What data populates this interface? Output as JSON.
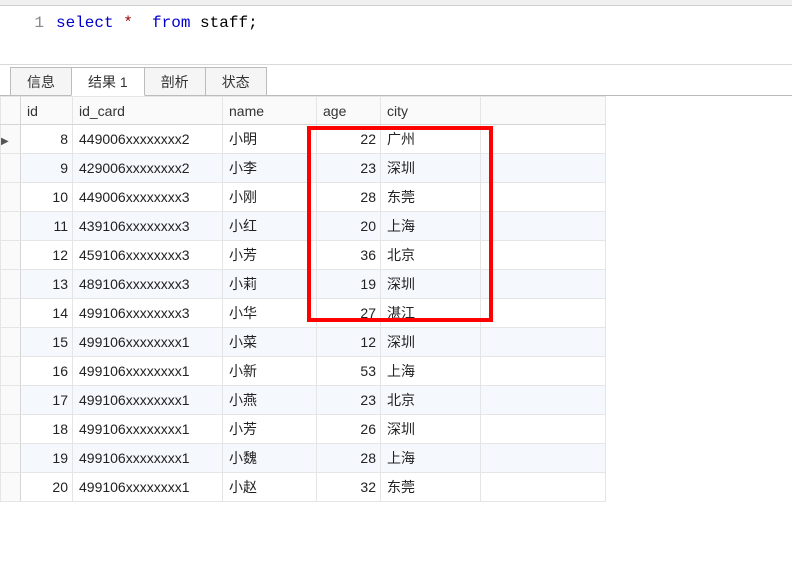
{
  "editor": {
    "line_number": "1",
    "sql_select": "select",
    "sql_star": "*",
    "sql_from": "from",
    "sql_table": "staff",
    "sql_end": ";"
  },
  "tabs": {
    "info": "信息",
    "result": "结果 1",
    "profile": "剖析",
    "status": "状态"
  },
  "columns": {
    "id": "id",
    "id_card": "id_card",
    "name": "name",
    "age": "age",
    "city": "city"
  },
  "pointer_glyph": "▶",
  "rows": [
    {
      "id": "8",
      "id_card": "449006xxxxxxxx2",
      "name": "小明",
      "age": "22",
      "city": "广州"
    },
    {
      "id": "9",
      "id_card": "429006xxxxxxxx2",
      "name": "小李",
      "age": "23",
      "city": "深圳"
    },
    {
      "id": "10",
      "id_card": "449006xxxxxxxx3",
      "name": "小刚",
      "age": "28",
      "city": "东莞"
    },
    {
      "id": "11",
      "id_card": "439106xxxxxxxx3",
      "name": "小红",
      "age": "20",
      "city": "上海"
    },
    {
      "id": "12",
      "id_card": "459106xxxxxxxx3",
      "name": "小芳",
      "age": "36",
      "city": "北京"
    },
    {
      "id": "13",
      "id_card": "489106xxxxxxxx3",
      "name": "小莉",
      "age": "19",
      "city": "深圳"
    },
    {
      "id": "14",
      "id_card": "499106xxxxxxxx3",
      "name": "小华",
      "age": "27",
      "city": "湛江"
    },
    {
      "id": "15",
      "id_card": "499106xxxxxxxx1",
      "name": "小菜",
      "age": "12",
      "city": "深圳"
    },
    {
      "id": "16",
      "id_card": "499106xxxxxxxx1",
      "name": "小新",
      "age": "53",
      "city": "上海"
    },
    {
      "id": "17",
      "id_card": "499106xxxxxxxx1",
      "name": "小燕",
      "age": "23",
      "city": "北京"
    },
    {
      "id": "18",
      "id_card": "499106xxxxxxxx1",
      "name": "小芳",
      "age": "26",
      "city": "深圳"
    },
    {
      "id": "19",
      "id_card": "499106xxxxxxxx1",
      "name": "小魏",
      "age": "28",
      "city": "上海"
    },
    {
      "id": "20",
      "id_card": "499106xxxxxxxx1",
      "name": "小赵",
      "age": "32",
      "city": "东莞"
    }
  ]
}
